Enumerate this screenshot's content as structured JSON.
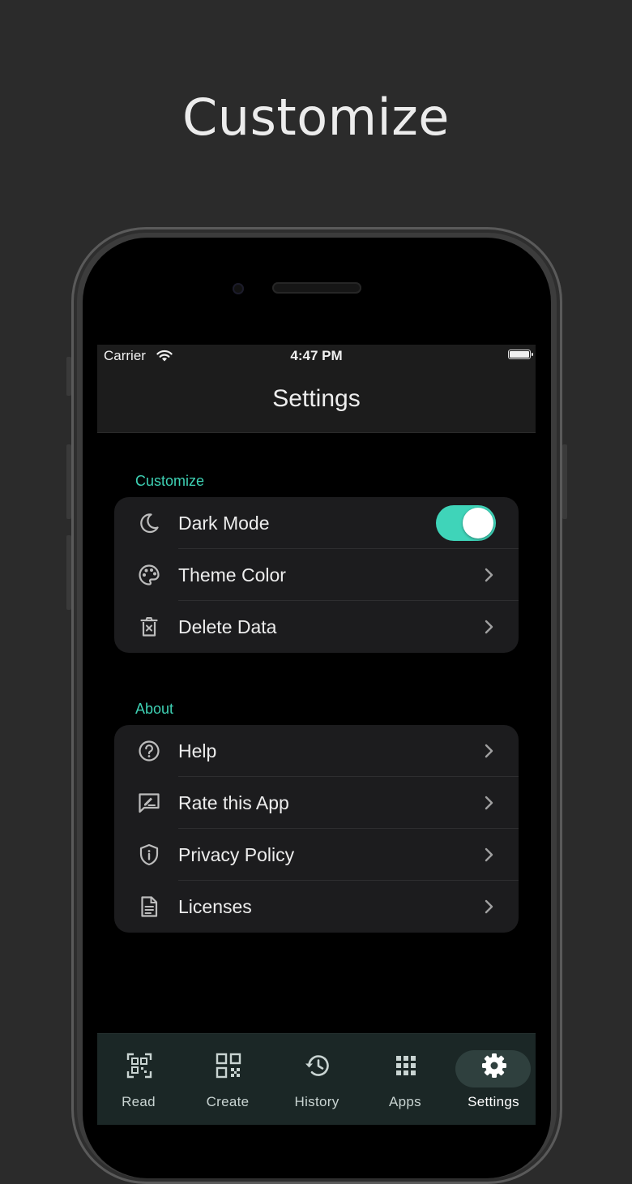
{
  "headline": "Customize",
  "statusbar": {
    "carrier": "Carrier",
    "time": "4:47 PM"
  },
  "navbar": {
    "title": "Settings"
  },
  "sections": {
    "customize": {
      "label": "Customize",
      "items": [
        {
          "label": "Dark Mode",
          "icon": "moon-icon",
          "control": "toggle",
          "toggle_on": true
        },
        {
          "label": "Theme Color",
          "icon": "palette-icon",
          "control": "chevron"
        },
        {
          "label": "Delete Data",
          "icon": "trash-icon",
          "control": "chevron"
        }
      ]
    },
    "about": {
      "label": "About",
      "items": [
        {
          "label": "Help",
          "icon": "help-circle-icon",
          "control": "chevron"
        },
        {
          "label": "Rate this App",
          "icon": "rate-review-icon",
          "control": "chevron"
        },
        {
          "label": "Privacy Policy",
          "icon": "shield-info-icon",
          "control": "chevron"
        },
        {
          "label": "Licenses",
          "icon": "document-icon",
          "control": "chevron"
        }
      ]
    }
  },
  "tabs": [
    {
      "label": "Read",
      "icon": "qr-scan-icon",
      "active": false
    },
    {
      "label": "Create",
      "icon": "qr-code-icon",
      "active": false
    },
    {
      "label": "History",
      "icon": "history-icon",
      "active": false
    },
    {
      "label": "Apps",
      "icon": "apps-grid-icon",
      "active": false
    },
    {
      "label": "Settings",
      "icon": "gear-icon",
      "active": true
    }
  ],
  "colors": {
    "accent": "#3ed1b4",
    "toggle_on": "#3fd4b9",
    "background": "#2b2b2b",
    "tab_bar": "#1b2726"
  }
}
